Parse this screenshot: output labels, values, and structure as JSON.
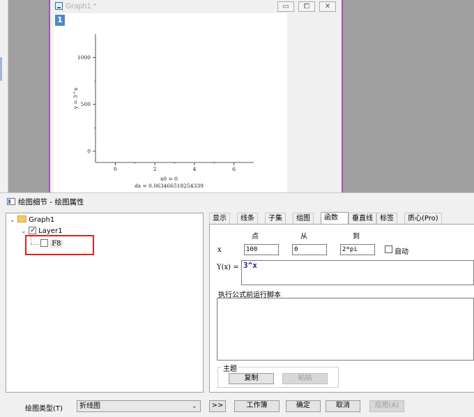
{
  "graph_window": {
    "title": "Graph1 *",
    "layer_number": "1",
    "buttons": {
      "minimize": "▭",
      "restore": "⧠",
      "close": "✕"
    }
  },
  "chart_data": {
    "type": "line",
    "series": [],
    "xlim": [
      -1,
      7
    ],
    "ylim": [
      -120,
      1250
    ],
    "x_ticks": [
      "0",
      "2",
      "4",
      "6"
    ],
    "y_ticks": [
      "0",
      "500",
      "1000"
    ],
    "ylabel": "y = 3^x",
    "xlabel": "x0 = 0",
    "footnote": "dx = 0.063466518254339"
  },
  "dialog": {
    "title": "绘图细节 - 绘图属性",
    "tree": {
      "root": "Graph1",
      "layer": "Layer1",
      "plot": "F8"
    },
    "tabs": [
      "显示",
      "线条",
      "子集",
      "组图",
      "函数",
      "垂直线",
      "标签",
      "质心(Pro)"
    ],
    "active_tab": "函数",
    "function_tab": {
      "col_points": "点",
      "col_from": "从",
      "col_to": "到",
      "x_label": "x",
      "points_value": "100",
      "from_value": "0",
      "to_value": "2*pi",
      "auto_label": "自动",
      "auto_checked": false,
      "y_label": "Y(x) =",
      "formula": "3^x",
      "script_label": "执行公式前运行脚本",
      "script_value": "",
      "theme_label": "主题",
      "copy_button": "复制",
      "paste_button": "粘贴"
    },
    "footer": {
      "plot_type_label": "绘图类型(T)",
      "plot_type_value": "折线图",
      "more_button": ">>",
      "workbook_button": "工作簿",
      "ok_button": "确定",
      "cancel_button": "取消",
      "apply_button": "应用(A)"
    }
  },
  "colors": {
    "highlight_box": "#e02020",
    "window_accent": "#a44fb8",
    "layer_badge": "#4d89c8",
    "formula_text": "#1b1b9e"
  }
}
